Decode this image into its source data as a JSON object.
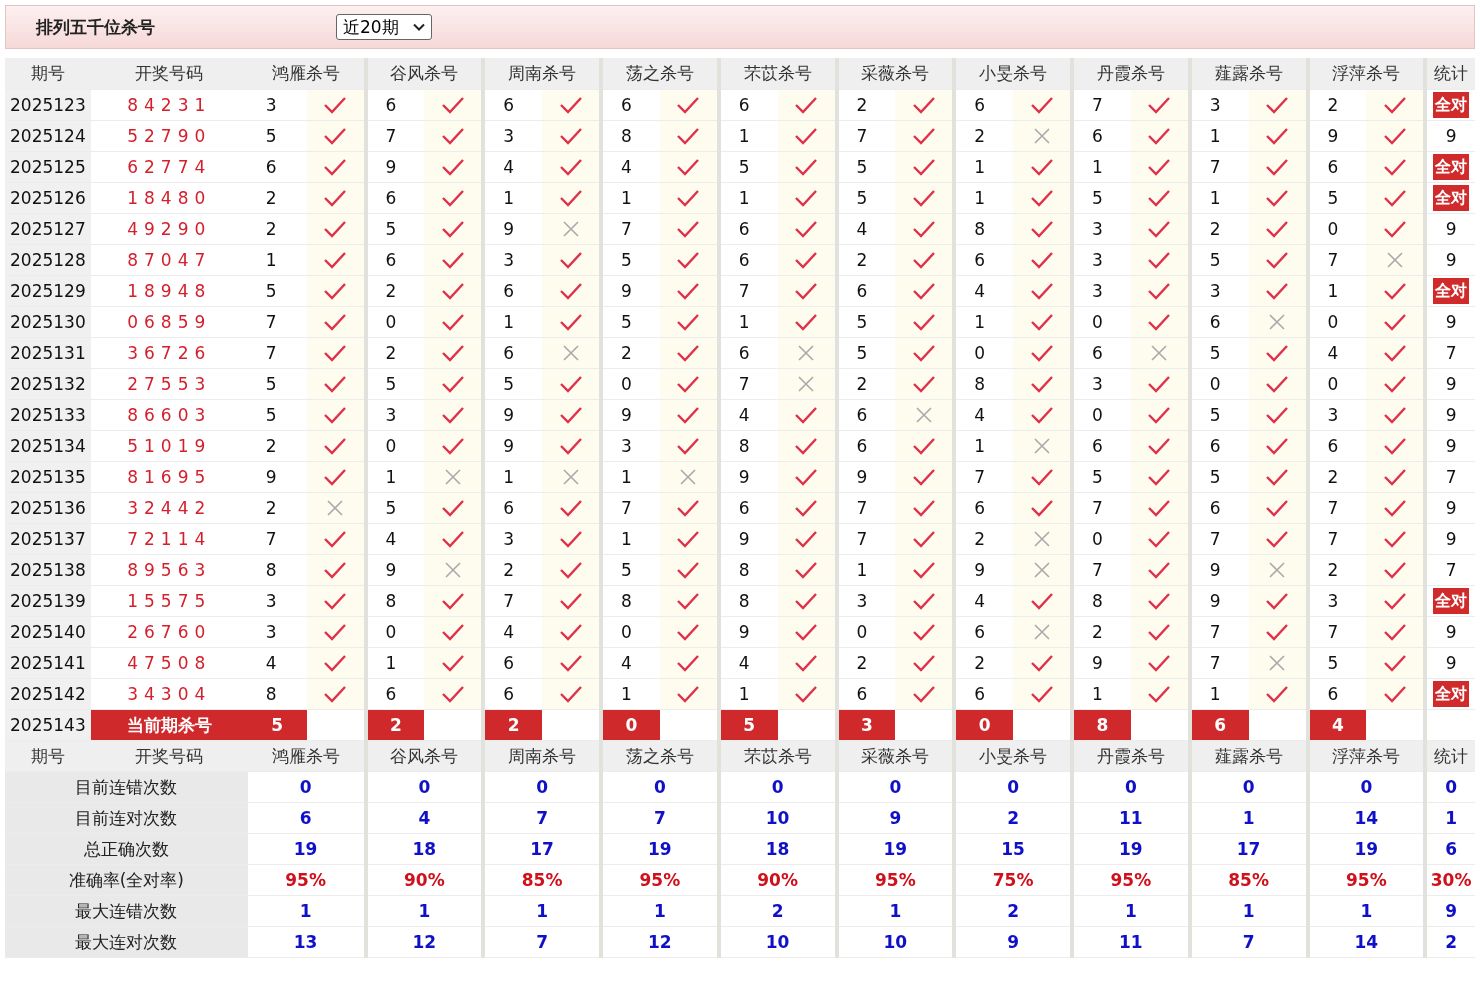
{
  "title": "排列五千位杀号",
  "range_select": {
    "value": "近20期"
  },
  "columns": {
    "period": "期号",
    "draw": "开奖号码",
    "experts": [
      "鸿雁杀号",
      "谷风杀号",
      "周南杀号",
      "荡之杀号",
      "芣苡杀号",
      "采薇杀号",
      "小旻杀号",
      "丹霞杀号",
      "薤露杀号",
      "浮萍杀号"
    ],
    "stat": "统计"
  },
  "rows": [
    {
      "period": "2025123",
      "draw": "84231",
      "picks": [
        {
          "n": "3",
          "hit": true
        },
        {
          "n": "6",
          "hit": true
        },
        {
          "n": "6",
          "hit": true
        },
        {
          "n": "6",
          "hit": true
        },
        {
          "n": "6",
          "hit": true
        },
        {
          "n": "2",
          "hit": true
        },
        {
          "n": "6",
          "hit": true
        },
        {
          "n": "7",
          "hit": true
        },
        {
          "n": "3",
          "hit": true
        },
        {
          "n": "2",
          "hit": true
        }
      ],
      "stat": {
        "kind": "badge",
        "text": "全对"
      }
    },
    {
      "period": "2025124",
      "draw": "52790",
      "picks": [
        {
          "n": "5",
          "hit": true
        },
        {
          "n": "7",
          "hit": true
        },
        {
          "n": "3",
          "hit": true
        },
        {
          "n": "8",
          "hit": true
        },
        {
          "n": "1",
          "hit": true
        },
        {
          "n": "7",
          "hit": true
        },
        {
          "n": "2",
          "hit": false
        },
        {
          "n": "6",
          "hit": true
        },
        {
          "n": "1",
          "hit": true
        },
        {
          "n": "9",
          "hit": true
        }
      ],
      "stat": {
        "kind": "count",
        "text": "9"
      }
    },
    {
      "period": "2025125",
      "draw": "62774",
      "picks": [
        {
          "n": "6",
          "hit": true
        },
        {
          "n": "9",
          "hit": true
        },
        {
          "n": "4",
          "hit": true
        },
        {
          "n": "4",
          "hit": true
        },
        {
          "n": "5",
          "hit": true
        },
        {
          "n": "5",
          "hit": true
        },
        {
          "n": "1",
          "hit": true
        },
        {
          "n": "1",
          "hit": true
        },
        {
          "n": "7",
          "hit": true
        },
        {
          "n": "6",
          "hit": true
        }
      ],
      "stat": {
        "kind": "badge",
        "text": "全对"
      }
    },
    {
      "period": "2025126",
      "draw": "18480",
      "picks": [
        {
          "n": "2",
          "hit": true
        },
        {
          "n": "6",
          "hit": true
        },
        {
          "n": "1",
          "hit": true
        },
        {
          "n": "1",
          "hit": true
        },
        {
          "n": "1",
          "hit": true
        },
        {
          "n": "5",
          "hit": true
        },
        {
          "n": "1",
          "hit": true
        },
        {
          "n": "5",
          "hit": true
        },
        {
          "n": "1",
          "hit": true
        },
        {
          "n": "5",
          "hit": true
        }
      ],
      "stat": {
        "kind": "badge",
        "text": "全对"
      }
    },
    {
      "period": "2025127",
      "draw": "49290",
      "picks": [
        {
          "n": "2",
          "hit": true
        },
        {
          "n": "5",
          "hit": true
        },
        {
          "n": "9",
          "hit": false
        },
        {
          "n": "7",
          "hit": true
        },
        {
          "n": "6",
          "hit": true
        },
        {
          "n": "4",
          "hit": true
        },
        {
          "n": "8",
          "hit": true
        },
        {
          "n": "3",
          "hit": true
        },
        {
          "n": "2",
          "hit": true
        },
        {
          "n": "0",
          "hit": true
        }
      ],
      "stat": {
        "kind": "count",
        "text": "9"
      }
    },
    {
      "period": "2025128",
      "draw": "87047",
      "picks": [
        {
          "n": "1",
          "hit": true
        },
        {
          "n": "6",
          "hit": true
        },
        {
          "n": "3",
          "hit": true
        },
        {
          "n": "5",
          "hit": true
        },
        {
          "n": "6",
          "hit": true
        },
        {
          "n": "2",
          "hit": true
        },
        {
          "n": "6",
          "hit": true
        },
        {
          "n": "3",
          "hit": true
        },
        {
          "n": "5",
          "hit": true
        },
        {
          "n": "7",
          "hit": false
        }
      ],
      "stat": {
        "kind": "count",
        "text": "9"
      }
    },
    {
      "period": "2025129",
      "draw": "18948",
      "picks": [
        {
          "n": "5",
          "hit": true
        },
        {
          "n": "2",
          "hit": true
        },
        {
          "n": "6",
          "hit": true
        },
        {
          "n": "9",
          "hit": true
        },
        {
          "n": "7",
          "hit": true
        },
        {
          "n": "6",
          "hit": true
        },
        {
          "n": "4",
          "hit": true
        },
        {
          "n": "3",
          "hit": true
        },
        {
          "n": "3",
          "hit": true
        },
        {
          "n": "1",
          "hit": true
        }
      ],
      "stat": {
        "kind": "badge",
        "text": "全对"
      }
    },
    {
      "period": "2025130",
      "draw": "06859",
      "picks": [
        {
          "n": "7",
          "hit": true
        },
        {
          "n": "0",
          "hit": true
        },
        {
          "n": "1",
          "hit": true
        },
        {
          "n": "5",
          "hit": true
        },
        {
          "n": "1",
          "hit": true
        },
        {
          "n": "5",
          "hit": true
        },
        {
          "n": "1",
          "hit": true
        },
        {
          "n": "0",
          "hit": true
        },
        {
          "n": "6",
          "hit": false
        },
        {
          "n": "0",
          "hit": true
        }
      ],
      "stat": {
        "kind": "count",
        "text": "9"
      }
    },
    {
      "period": "2025131",
      "draw": "36726",
      "picks": [
        {
          "n": "7",
          "hit": true
        },
        {
          "n": "2",
          "hit": true
        },
        {
          "n": "6",
          "hit": false
        },
        {
          "n": "2",
          "hit": true
        },
        {
          "n": "6",
          "hit": false
        },
        {
          "n": "5",
          "hit": true
        },
        {
          "n": "0",
          "hit": true
        },
        {
          "n": "6",
          "hit": false
        },
        {
          "n": "5",
          "hit": true
        },
        {
          "n": "4",
          "hit": true
        }
      ],
      "stat": {
        "kind": "count",
        "text": "7"
      }
    },
    {
      "period": "2025132",
      "draw": "27553",
      "picks": [
        {
          "n": "5",
          "hit": true
        },
        {
          "n": "5",
          "hit": true
        },
        {
          "n": "5",
          "hit": true
        },
        {
          "n": "0",
          "hit": true
        },
        {
          "n": "7",
          "hit": false
        },
        {
          "n": "2",
          "hit": true
        },
        {
          "n": "8",
          "hit": true
        },
        {
          "n": "3",
          "hit": true
        },
        {
          "n": "0",
          "hit": true
        },
        {
          "n": "0",
          "hit": true
        }
      ],
      "stat": {
        "kind": "count",
        "text": "9"
      }
    },
    {
      "period": "2025133",
      "draw": "86603",
      "picks": [
        {
          "n": "5",
          "hit": true
        },
        {
          "n": "3",
          "hit": true
        },
        {
          "n": "9",
          "hit": true
        },
        {
          "n": "9",
          "hit": true
        },
        {
          "n": "4",
          "hit": true
        },
        {
          "n": "6",
          "hit": false
        },
        {
          "n": "4",
          "hit": true
        },
        {
          "n": "0",
          "hit": true
        },
        {
          "n": "5",
          "hit": true
        },
        {
          "n": "3",
          "hit": true
        }
      ],
      "stat": {
        "kind": "count",
        "text": "9"
      }
    },
    {
      "period": "2025134",
      "draw": "51019",
      "picks": [
        {
          "n": "2",
          "hit": true
        },
        {
          "n": "0",
          "hit": true
        },
        {
          "n": "9",
          "hit": true
        },
        {
          "n": "3",
          "hit": true
        },
        {
          "n": "8",
          "hit": true
        },
        {
          "n": "6",
          "hit": true
        },
        {
          "n": "1",
          "hit": false
        },
        {
          "n": "6",
          "hit": true
        },
        {
          "n": "6",
          "hit": true
        },
        {
          "n": "6",
          "hit": true
        }
      ],
      "stat": {
        "kind": "count",
        "text": "9"
      }
    },
    {
      "period": "2025135",
      "draw": "81695",
      "picks": [
        {
          "n": "9",
          "hit": true
        },
        {
          "n": "1",
          "hit": false
        },
        {
          "n": "1",
          "hit": false
        },
        {
          "n": "1",
          "hit": false
        },
        {
          "n": "9",
          "hit": true
        },
        {
          "n": "9",
          "hit": true
        },
        {
          "n": "7",
          "hit": true
        },
        {
          "n": "5",
          "hit": true
        },
        {
          "n": "5",
          "hit": true
        },
        {
          "n": "2",
          "hit": true
        }
      ],
      "stat": {
        "kind": "count",
        "text": "7"
      }
    },
    {
      "period": "2025136",
      "draw": "32442",
      "picks": [
        {
          "n": "2",
          "hit": false
        },
        {
          "n": "5",
          "hit": true
        },
        {
          "n": "6",
          "hit": true
        },
        {
          "n": "7",
          "hit": true
        },
        {
          "n": "6",
          "hit": true
        },
        {
          "n": "7",
          "hit": true
        },
        {
          "n": "6",
          "hit": true
        },
        {
          "n": "7",
          "hit": true
        },
        {
          "n": "6",
          "hit": true
        },
        {
          "n": "7",
          "hit": true
        }
      ],
      "stat": {
        "kind": "count",
        "text": "9"
      }
    },
    {
      "period": "2025137",
      "draw": "72114",
      "picks": [
        {
          "n": "7",
          "hit": true
        },
        {
          "n": "4",
          "hit": true
        },
        {
          "n": "3",
          "hit": true
        },
        {
          "n": "1",
          "hit": true
        },
        {
          "n": "9",
          "hit": true
        },
        {
          "n": "7",
          "hit": true
        },
        {
          "n": "2",
          "hit": false
        },
        {
          "n": "0",
          "hit": true
        },
        {
          "n": "7",
          "hit": true
        },
        {
          "n": "7",
          "hit": true
        }
      ],
      "stat": {
        "kind": "count",
        "text": "9"
      }
    },
    {
      "period": "2025138",
      "draw": "89563",
      "picks": [
        {
          "n": "8",
          "hit": true
        },
        {
          "n": "9",
          "hit": false
        },
        {
          "n": "2",
          "hit": true
        },
        {
          "n": "5",
          "hit": true
        },
        {
          "n": "8",
          "hit": true
        },
        {
          "n": "1",
          "hit": true
        },
        {
          "n": "9",
          "hit": false
        },
        {
          "n": "7",
          "hit": true
        },
        {
          "n": "9",
          "hit": false
        },
        {
          "n": "2",
          "hit": true
        }
      ],
      "stat": {
        "kind": "count",
        "text": "7"
      }
    },
    {
      "period": "2025139",
      "draw": "15575",
      "picks": [
        {
          "n": "3",
          "hit": true
        },
        {
          "n": "8",
          "hit": true
        },
        {
          "n": "7",
          "hit": true
        },
        {
          "n": "8",
          "hit": true
        },
        {
          "n": "8",
          "hit": true
        },
        {
          "n": "3",
          "hit": true
        },
        {
          "n": "4",
          "hit": true
        },
        {
          "n": "8",
          "hit": true
        },
        {
          "n": "9",
          "hit": true
        },
        {
          "n": "3",
          "hit": true
        }
      ],
      "stat": {
        "kind": "badge",
        "text": "全对"
      }
    },
    {
      "period": "2025140",
      "draw": "26760",
      "picks": [
        {
          "n": "3",
          "hit": true
        },
        {
          "n": "0",
          "hit": true
        },
        {
          "n": "4",
          "hit": true
        },
        {
          "n": "0",
          "hit": true
        },
        {
          "n": "9",
          "hit": true
        },
        {
          "n": "0",
          "hit": true
        },
        {
          "n": "6",
          "hit": false
        },
        {
          "n": "2",
          "hit": true
        },
        {
          "n": "7",
          "hit": true
        },
        {
          "n": "7",
          "hit": true
        }
      ],
      "stat": {
        "kind": "count",
        "text": "9"
      }
    },
    {
      "period": "2025141",
      "draw": "47508",
      "picks": [
        {
          "n": "4",
          "hit": true
        },
        {
          "n": "1",
          "hit": true
        },
        {
          "n": "6",
          "hit": true
        },
        {
          "n": "4",
          "hit": true
        },
        {
          "n": "4",
          "hit": true
        },
        {
          "n": "2",
          "hit": true
        },
        {
          "n": "2",
          "hit": true
        },
        {
          "n": "9",
          "hit": true
        },
        {
          "n": "7",
          "hit": false
        },
        {
          "n": "5",
          "hit": true
        }
      ],
      "stat": {
        "kind": "count",
        "text": "9"
      }
    },
    {
      "period": "2025142",
      "draw": "34304",
      "picks": [
        {
          "n": "8",
          "hit": true
        },
        {
          "n": "6",
          "hit": true
        },
        {
          "n": "6",
          "hit": true
        },
        {
          "n": "1",
          "hit": true
        },
        {
          "n": "1",
          "hit": true
        },
        {
          "n": "6",
          "hit": true
        },
        {
          "n": "6",
          "hit": true
        },
        {
          "n": "1",
          "hit": true
        },
        {
          "n": "1",
          "hit": true
        },
        {
          "n": "6",
          "hit": true
        }
      ],
      "stat": {
        "kind": "badge",
        "text": "全对"
      }
    }
  ],
  "current": {
    "period": "2025143",
    "label": "当前期杀号",
    "picks": [
      "5",
      "2",
      "2",
      "0",
      "5",
      "3",
      "0",
      "8",
      "6",
      "4"
    ]
  },
  "footer_columns": {
    "period": "期号",
    "draw": "开奖号码",
    "experts": [
      "鸿雁杀号",
      "谷风杀号",
      "周南杀号",
      "荡之杀号",
      "芣苡杀号",
      "采薇杀号",
      "小旻杀号",
      "丹霞杀号",
      "薤露杀号",
      "浮萍杀号"
    ],
    "stat": "统计"
  },
  "summary": [
    {
      "label": "目前连错次数",
      "kind": "count",
      "values": [
        "0",
        "0",
        "0",
        "0",
        "0",
        "0",
        "0",
        "0",
        "0",
        "0"
      ],
      "stat": "0"
    },
    {
      "label": "目前连对次数",
      "kind": "count",
      "values": [
        "6",
        "4",
        "7",
        "7",
        "10",
        "9",
        "2",
        "11",
        "1",
        "14"
      ],
      "stat": "1"
    },
    {
      "label": "总正确次数",
      "kind": "count",
      "values": [
        "19",
        "18",
        "17",
        "19",
        "18",
        "19",
        "15",
        "19",
        "17",
        "19"
      ],
      "stat": "6"
    },
    {
      "label": "准确率(全对率)",
      "kind": "rate",
      "values": [
        "95%",
        "90%",
        "85%",
        "95%",
        "90%",
        "95%",
        "75%",
        "95%",
        "85%",
        "95%"
      ],
      "stat": "30%"
    },
    {
      "label": "最大连错次数",
      "kind": "count",
      "values": [
        "1",
        "1",
        "1",
        "1",
        "2",
        "1",
        "2",
        "1",
        "1",
        "1"
      ],
      "stat": "9"
    },
    {
      "label": "最大连对次数",
      "kind": "count",
      "values": [
        "13",
        "12",
        "7",
        "12",
        "10",
        "10",
        "9",
        "11",
        "7",
        "14"
      ],
      "stat": "2"
    }
  ]
}
